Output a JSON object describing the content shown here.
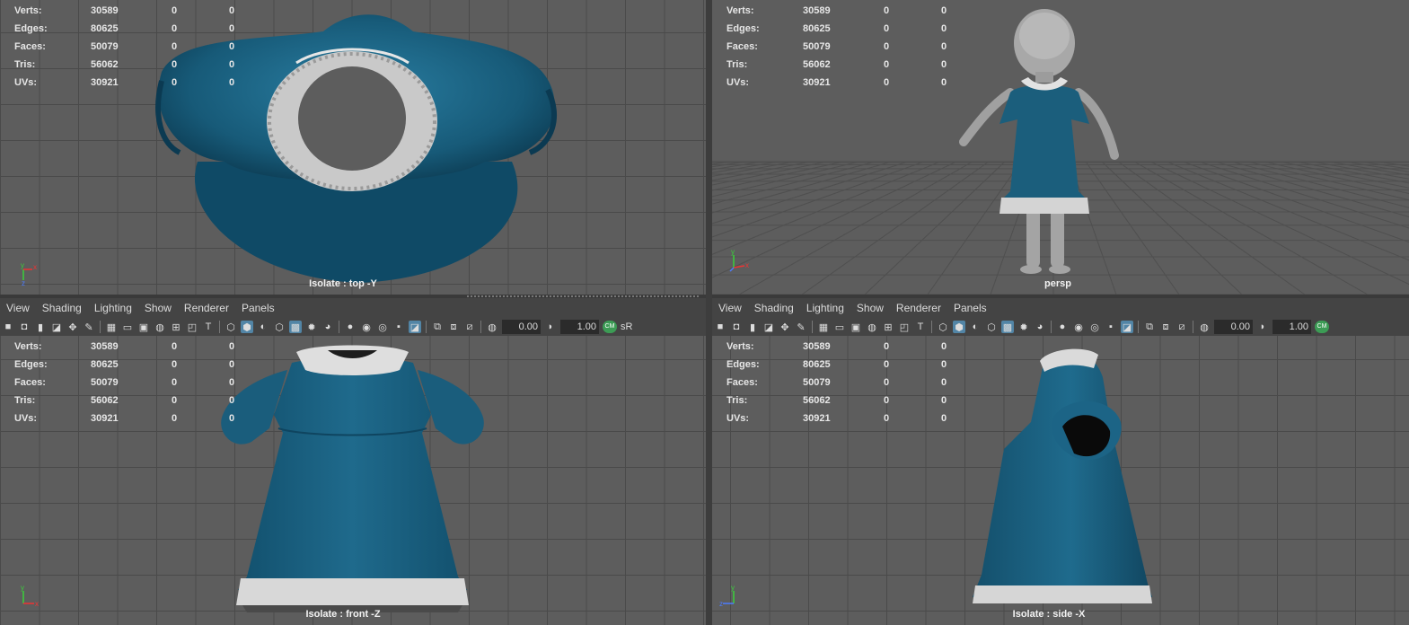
{
  "hud": {
    "rows": [
      {
        "label": "Verts:",
        "values": [
          "30589",
          "0",
          "0"
        ]
      },
      {
        "label": "Edges:",
        "values": [
          "80625",
          "0",
          "0"
        ]
      },
      {
        "label": "Faces:",
        "values": [
          "50079",
          "0",
          "0"
        ]
      },
      {
        "label": "Tris:",
        "values": [
          "56062",
          "0",
          "0"
        ]
      },
      {
        "label": "UVs:",
        "values": [
          "30921",
          "0",
          "0"
        ]
      }
    ]
  },
  "viewports": {
    "top_left": {
      "camera_label": "Isolate : top -Y"
    },
    "top_right": {
      "camera_label": "persp"
    },
    "bottom_left": {
      "camera_label": "Isolate : front -Z"
    },
    "bottom_right": {
      "camera_label": "Isolate : side -X"
    }
  },
  "panel_menu": [
    "View",
    "Shading",
    "Lighting",
    "Show",
    "Renderer",
    "Panels"
  ],
  "panel_toolbar": {
    "exposure_value": "0.00",
    "gamma_value": "1.00",
    "colorspace_label": "sR"
  },
  "gizmo_labels": {
    "y": "y",
    "x": "x",
    "z": "z"
  },
  "colors": {
    "viewport_bg": "#5d5d5d",
    "grid_line": "#4a4a4a",
    "dress_blue": "#1b5e7c",
    "lace_white": "#d6d6d6",
    "highlight_blue": "#5285a6"
  }
}
